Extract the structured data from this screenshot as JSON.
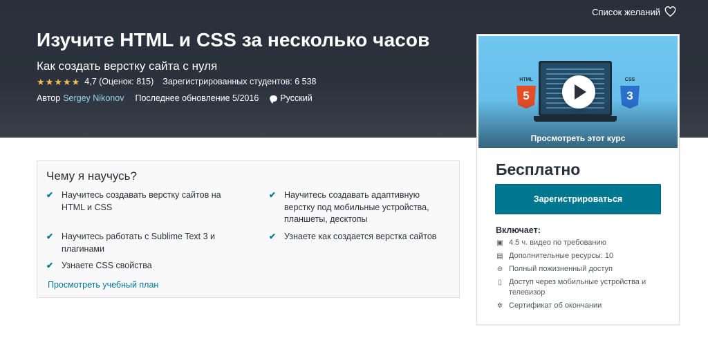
{
  "header": {
    "wishlist_label": "Список желаний",
    "title": "Изучите HTML и CSS за несколько часов",
    "subtitle": "Как создать верстку сайта с нуля",
    "stars": [
      "★",
      "★",
      "★",
      "★",
      "★"
    ],
    "rating": "4,7 (Оценок: 815)",
    "enrolled": "Зарегистрированных студентов: 6 538",
    "author_prefix": "Автор",
    "author_name": "Sergey Nikonov",
    "last_updated": "Последнее обновление 5/2016",
    "language": "Русский"
  },
  "sidebar": {
    "preview": {
      "html_badge": "HTML",
      "html_number": "5",
      "css_badge": "CSS",
      "css_number": "3",
      "label": "Просмотреть этот курс"
    },
    "price": "Бесплатно",
    "enroll_label": "Зарегистрироваться",
    "includes_title": "Включает:",
    "includes": [
      {
        "icon": "video-icon",
        "glyph": "▣",
        "text": "4.5 ч. видео по требованию"
      },
      {
        "icon": "file-icon",
        "glyph": "▤",
        "text": "Дополнительные ресурсы: 10"
      },
      {
        "icon": "infinity-icon",
        "glyph": "⊖",
        "text": "Полный пожизненный доступ"
      },
      {
        "icon": "mobile-icon",
        "glyph": "▯",
        "text": "Доступ через мобильные устройства и телевизор"
      },
      {
        "icon": "certificate-icon",
        "glyph": "✲",
        "text": "Сертификат об окончании"
      }
    ]
  },
  "learn": {
    "title": "Чему я научусь?",
    "check_glyph": "✔",
    "items": [
      "Научитесь создавать верстку сайтов на HTML и CSS",
      "Научитесь создавать адаптивную верстку под мобильные устройства, планшеты, десктопы",
      "Научитесь работать с Sublime Text 3 и плагинами",
      "Узнаете как создается верстка сайтов",
      "Узнаете CSS свойства"
    ],
    "curriculum_link": "Просмотреть учебный план"
  },
  "colors": {
    "hero_bg": "#29303b",
    "accent": "#007791",
    "star": "#f4c150",
    "link_light": "#9ad7ed"
  }
}
